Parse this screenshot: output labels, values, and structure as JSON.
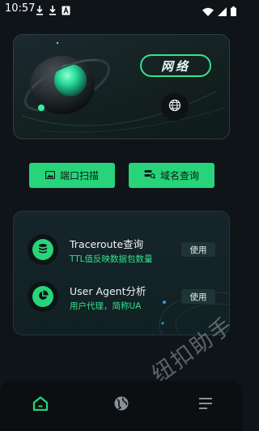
{
  "status_bar": {
    "time": "10:57",
    "icons": [
      "download-icon",
      "download-icon",
      "font-a-icon",
      "wifi-icon",
      "signal-icon",
      "battery-icon"
    ]
  },
  "hero": {
    "title": "网络",
    "action_icon": "globe-icon"
  },
  "tools": {
    "port_scan_label": "端口扫描",
    "domain_query_label": "域名查询"
  },
  "list": {
    "items": [
      {
        "title": "Traceroute查询",
        "subtitle": "TTL值反映数据包数量",
        "button": "使用",
        "icon": "database-icon"
      },
      {
        "title": "User Agent分析",
        "subtitle": "用户代理，简称UA",
        "button": "使用",
        "icon": "pie-chart-icon"
      }
    ]
  },
  "watermark": "纽扣助手",
  "nav": {
    "items": [
      "home-icon",
      "globe-icon",
      "more-icon"
    ],
    "active": "home-icon"
  },
  "colors": {
    "background": "#0f1419",
    "accent": "#27d47a",
    "subtitle_green": "#33e08a",
    "card_border": "#2f3d44"
  }
}
